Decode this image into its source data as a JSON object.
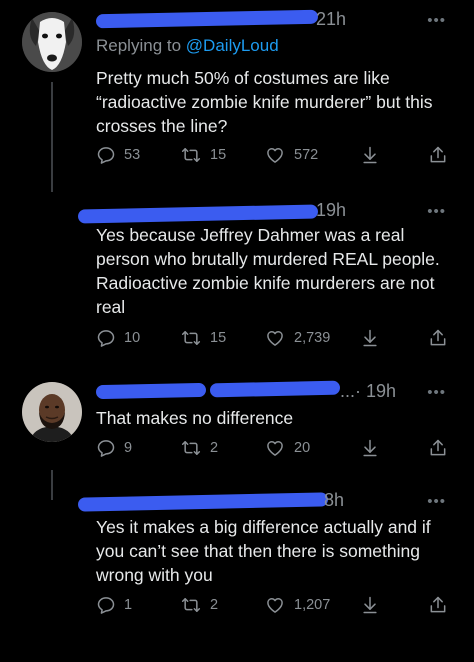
{
  "colors": {
    "background": "#000000",
    "text": "#e7e9ea",
    "muted": "#8b9095",
    "link": "#1d9bf0",
    "redaction": "#3b5cf0"
  },
  "tweets": [
    {
      "time": "21h",
      "replying_prefix": "Replying to",
      "replying_handle": "@DailyLoud",
      "text": "Pretty much 50% of costumes are like “radioactive zombie knife murderer” but this crosses the line?",
      "replies": "53",
      "retweets": "15",
      "likes": "572",
      "avatar": "dog-avatar"
    },
    {
      "time": "19h",
      "text": "Yes because Jeffrey Dahmer was a real person who brutally murdered REAL people. Radioactive zombie knife murderers are not real",
      "replies": "10",
      "retweets": "15",
      "likes": "2,739"
    },
    {
      "time": "...· 19h",
      "text": "That makes no difference",
      "replies": "9",
      "retweets": "2",
      "likes": "20",
      "avatar": "man-avatar"
    },
    {
      "time": "8h",
      "text": "Yes it makes a big difference actually and if you can’t see that then there is something wrong with you",
      "replies": "1",
      "retweets": "2",
      "likes": "1,207"
    }
  ],
  "more_label": "•••",
  "icons": [
    "reply-icon",
    "retweet-icon",
    "like-icon",
    "download-icon",
    "share-icon"
  ]
}
